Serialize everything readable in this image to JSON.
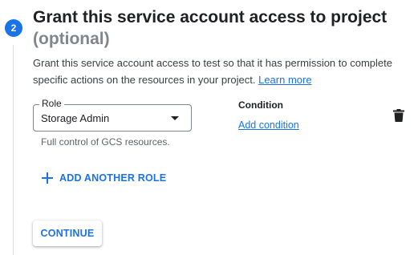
{
  "step": {
    "number": "2",
    "title": "Grant this service account access to project",
    "optional_label": "(optional)",
    "description": "Grant this service account access to test so that it has permission to complete specific actions on the resources in your project.",
    "learn_more_label": "Learn more"
  },
  "role": {
    "label": "Role",
    "value": "Storage Admin",
    "hint": "Full control of GCS resources."
  },
  "condition": {
    "heading": "Condition",
    "add_label": "Add condition"
  },
  "actions": {
    "delete_icon": "trash-icon",
    "add_another_role_label": "ADD ANOTHER ROLE",
    "continue_label": "CONTINUE"
  },
  "colors": {
    "accent": "#1a73e8",
    "text": "#202124",
    "muted": "#80868b"
  }
}
